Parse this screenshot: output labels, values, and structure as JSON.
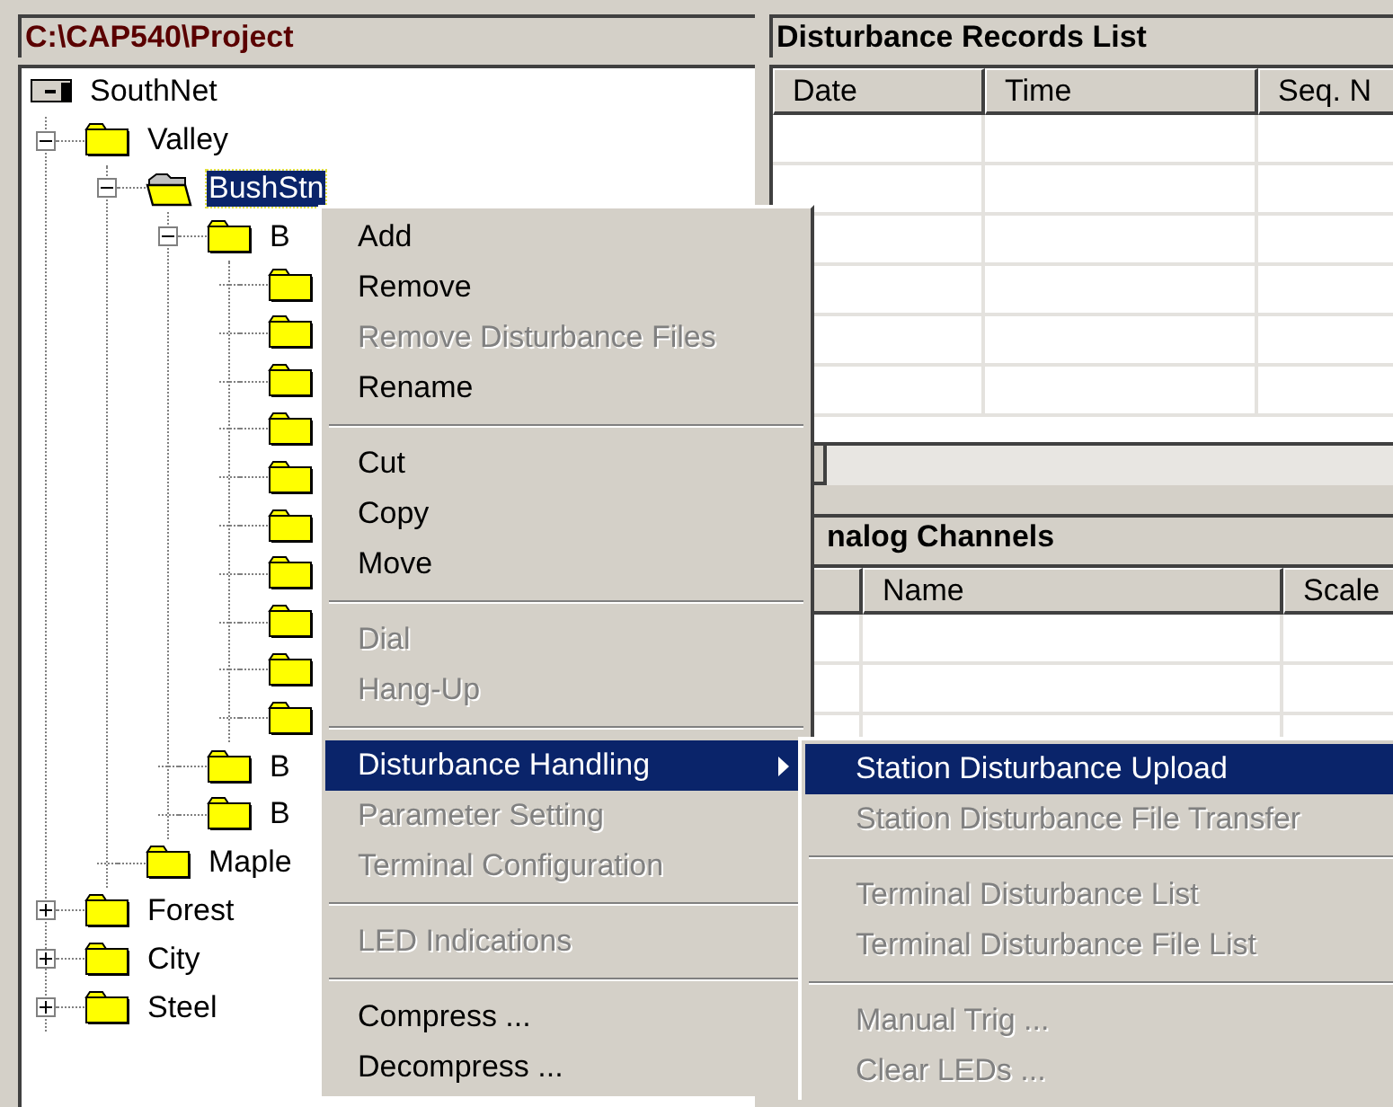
{
  "project_pane": {
    "title": "C:\\CAP540\\Project",
    "tree": [
      {
        "label": "SouthNet",
        "kind": "network",
        "selected": false,
        "children": [
          {
            "label": "Valley",
            "kind": "folder",
            "expanded": true,
            "selected": false,
            "children": [
              {
                "label": "BushStn",
                "kind": "folder",
                "expanded": true,
                "selected": true,
                "children": [
                  {
                    "label": "B",
                    "kind": "folder",
                    "expanded": true,
                    "selected": false,
                    "children": [
                      {
                        "kind": "folder",
                        "selected": false
                      },
                      {
                        "kind": "folder",
                        "selected": false
                      },
                      {
                        "kind": "folder",
                        "selected": false
                      },
                      {
                        "kind": "folder",
                        "selected": false
                      },
                      {
                        "kind": "folder",
                        "selected": false
                      },
                      {
                        "kind": "folder",
                        "selected": false
                      },
                      {
                        "kind": "folder",
                        "selected": false
                      },
                      {
                        "kind": "folder",
                        "selected": false
                      },
                      {
                        "kind": "folder",
                        "selected": false
                      },
                      {
                        "kind": "folder",
                        "selected": false
                      }
                    ]
                  },
                  {
                    "label": "B",
                    "kind": "folder",
                    "selected": false
                  },
                  {
                    "label": "B",
                    "kind": "folder",
                    "selected": false
                  }
                ]
              },
              {
                "label": "Maple",
                "kind": "folder",
                "selected": false
              }
            ]
          },
          {
            "label": "Forest",
            "kind": "folder",
            "expanded": false,
            "selected": false
          },
          {
            "label": "City",
            "kind": "folder",
            "expanded": false,
            "selected": false
          },
          {
            "label": "Steel",
            "kind": "folder",
            "expanded": false,
            "selected": false
          }
        ]
      }
    ]
  },
  "records_pane": {
    "title": "Disturbance Records List",
    "columns": [
      "Date",
      "Time",
      "Seq. N"
    ]
  },
  "channels_pane": {
    "title": "nalog Channels",
    "columns": [
      "Name",
      "Scale"
    ]
  },
  "context_menu": {
    "items": [
      {
        "kind": "item",
        "label": "Add",
        "disabled": false,
        "selected": false
      },
      {
        "kind": "item",
        "label": "Remove",
        "disabled": false,
        "selected": false
      },
      {
        "kind": "item",
        "label": "Remove Disturbance Files",
        "disabled": true,
        "selected": false
      },
      {
        "kind": "item",
        "label": "Rename",
        "disabled": false,
        "selected": false
      },
      {
        "kind": "separator"
      },
      {
        "kind": "item",
        "label": "Cut",
        "disabled": false,
        "selected": false
      },
      {
        "kind": "item",
        "label": "Copy",
        "disabled": false,
        "selected": false
      },
      {
        "kind": "item",
        "label": "Move",
        "disabled": false,
        "selected": false
      },
      {
        "kind": "separator"
      },
      {
        "kind": "item",
        "label": "Dial",
        "disabled": true,
        "selected": false
      },
      {
        "kind": "item",
        "label": "Hang-Up",
        "disabled": true,
        "selected": false
      },
      {
        "kind": "separator"
      },
      {
        "kind": "submenu",
        "label": "Disturbance Handling",
        "disabled": false,
        "selected": true
      },
      {
        "kind": "item",
        "label": "Parameter Setting",
        "disabled": true,
        "selected": false
      },
      {
        "kind": "item",
        "label": "Terminal Configuration",
        "disabled": true,
        "selected": false
      },
      {
        "kind": "separator"
      },
      {
        "kind": "item",
        "label": "LED Indications",
        "disabled": true,
        "selected": false
      },
      {
        "kind": "separator"
      },
      {
        "kind": "item",
        "label": "Compress ...",
        "disabled": false,
        "selected": false
      },
      {
        "kind": "item",
        "label": "Decompress ...",
        "disabled": false,
        "selected": false
      }
    ]
  },
  "submenu": {
    "items": [
      {
        "kind": "item",
        "label": "Station Disturbance Upload",
        "disabled": false,
        "selected": true
      },
      {
        "kind": "item",
        "label": "Station Disturbance File Transfer",
        "disabled": true,
        "selected": false
      },
      {
        "kind": "separator"
      },
      {
        "kind": "item",
        "label": "Terminal Disturbance List",
        "disabled": true,
        "selected": false
      },
      {
        "kind": "item",
        "label": "Terminal Disturbance File List",
        "disabled": true,
        "selected": false
      },
      {
        "kind": "separator"
      },
      {
        "kind": "item",
        "label": "Manual Trig ...",
        "disabled": true,
        "selected": false
      },
      {
        "kind": "item",
        "label": "Clear LEDs ...",
        "disabled": true,
        "selected": false
      }
    ]
  }
}
